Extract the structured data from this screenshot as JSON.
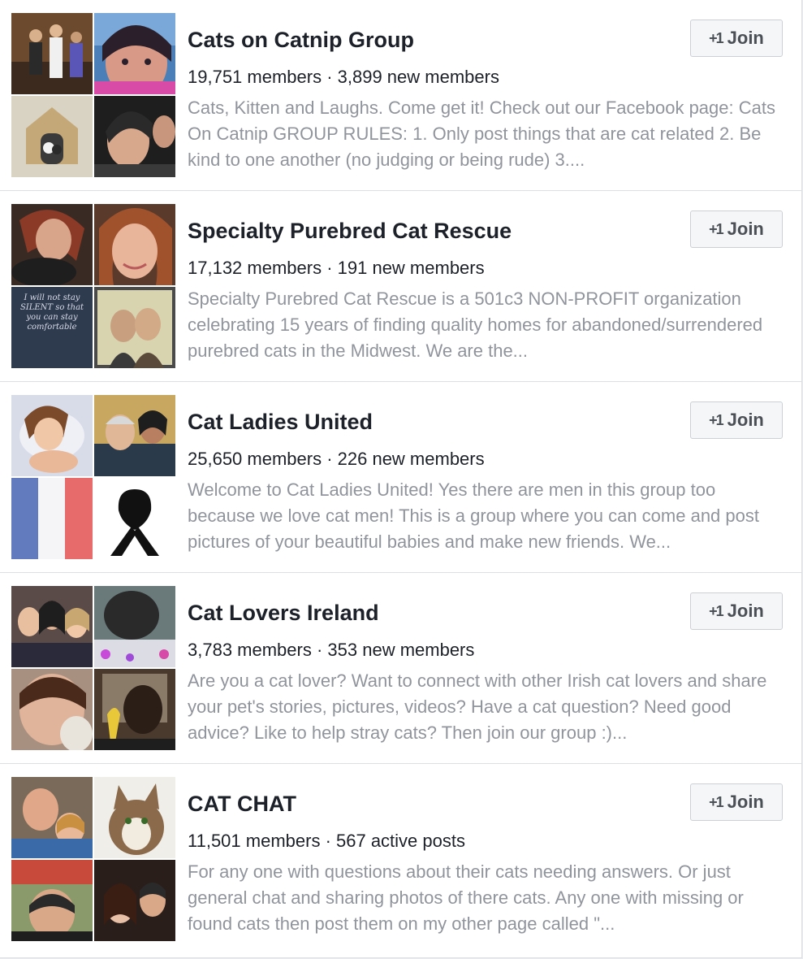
{
  "join_button": {
    "icon": "+1",
    "label": "Join",
    "icon_name": "add-friend-plus-one-icon"
  },
  "colors": {
    "title": "#1d2129",
    "description": "#90949c",
    "button_bg": "#f5f6f7",
    "button_border": "#ccd0d5"
  },
  "groups": [
    {
      "title": "Cats on Catnip Group",
      "stats": "19,751 members · 3,899 new members",
      "description": "Cats, Kitten and Laughs. Come get it! Check out our Facebook page: Cats On Catnip GROUP RULES: 1. Only post things that are cat related 2. Be kind to one another (no judging or being rude) 3...."
    },
    {
      "title": "Specialty Purebred Cat Rescue",
      "stats": "17,132 members · 191 new members",
      "description": "Specialty Purebred Cat Rescue is a 501c3 NON-PROFIT organization celebrating 15 years of finding quality homes for abandoned/surrendered purebred cats in the Midwest. We are the...",
      "photo_caption": "I will not stay SILENT so that you can stay comfortable"
    },
    {
      "title": "Cat Ladies United",
      "stats": "25,650 members · 226 new members",
      "description": "Welcome to Cat Ladies United! Yes there are men in this group too because we love cat men! This is a group where you can come and post pictures of your beautiful babies and make new friends. We..."
    },
    {
      "title": "Cat Lovers Ireland",
      "stats": "3,783 members · 353 new members",
      "description": "Are you a cat lover? Want to connect with other Irish cat lovers and share your pet's stories, pictures, videos? Have a cat question? Need good advice? Like to help stray cats? Then join our group :)..."
    },
    {
      "title": "CAT CHAT",
      "stats": "11,501 members · 567 active posts",
      "description": "For any one with questions about their cats needing answers. Or just general chat and sharing photos of there cats. Any one with missing or found cats then post them on my other page called \"..."
    }
  ]
}
